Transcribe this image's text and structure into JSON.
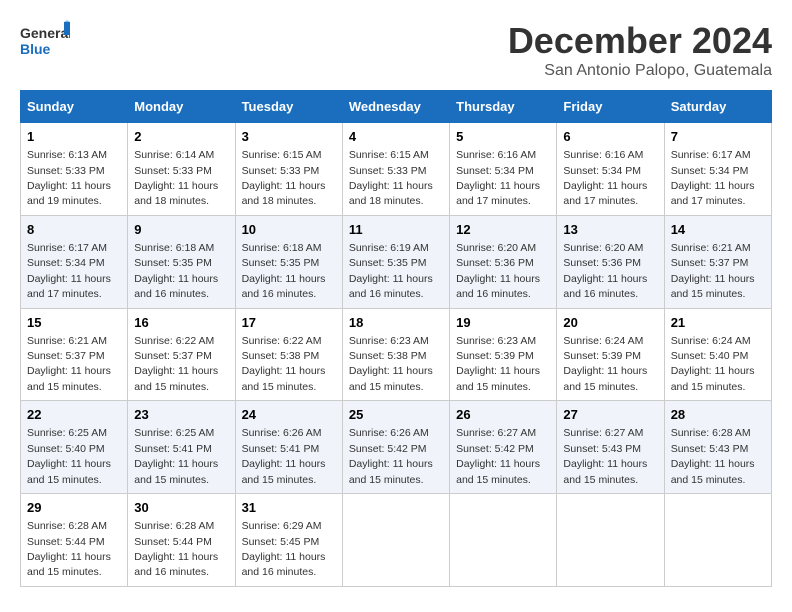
{
  "logo": {
    "line1": "General",
    "line2": "Blue"
  },
  "title": "December 2024",
  "subtitle": "San Antonio Palopo, Guatemala",
  "weekdays": [
    "Sunday",
    "Monday",
    "Tuesday",
    "Wednesday",
    "Thursday",
    "Friday",
    "Saturday"
  ],
  "weeks": [
    [
      {
        "day": "1",
        "sunrise": "6:13 AM",
        "sunset": "5:33 PM",
        "daylight": "11 hours and 19 minutes."
      },
      {
        "day": "2",
        "sunrise": "6:14 AM",
        "sunset": "5:33 PM",
        "daylight": "11 hours and 18 minutes."
      },
      {
        "day": "3",
        "sunrise": "6:15 AM",
        "sunset": "5:33 PM",
        "daylight": "11 hours and 18 minutes."
      },
      {
        "day": "4",
        "sunrise": "6:15 AM",
        "sunset": "5:33 PM",
        "daylight": "11 hours and 18 minutes."
      },
      {
        "day": "5",
        "sunrise": "6:16 AM",
        "sunset": "5:34 PM",
        "daylight": "11 hours and 17 minutes."
      },
      {
        "day": "6",
        "sunrise": "6:16 AM",
        "sunset": "5:34 PM",
        "daylight": "11 hours and 17 minutes."
      },
      {
        "day": "7",
        "sunrise": "6:17 AM",
        "sunset": "5:34 PM",
        "daylight": "11 hours and 17 minutes."
      }
    ],
    [
      {
        "day": "8",
        "sunrise": "6:17 AM",
        "sunset": "5:34 PM",
        "daylight": "11 hours and 17 minutes."
      },
      {
        "day": "9",
        "sunrise": "6:18 AM",
        "sunset": "5:35 PM",
        "daylight": "11 hours and 16 minutes."
      },
      {
        "day": "10",
        "sunrise": "6:18 AM",
        "sunset": "5:35 PM",
        "daylight": "11 hours and 16 minutes."
      },
      {
        "day": "11",
        "sunrise": "6:19 AM",
        "sunset": "5:35 PM",
        "daylight": "11 hours and 16 minutes."
      },
      {
        "day": "12",
        "sunrise": "6:20 AM",
        "sunset": "5:36 PM",
        "daylight": "11 hours and 16 minutes."
      },
      {
        "day": "13",
        "sunrise": "6:20 AM",
        "sunset": "5:36 PM",
        "daylight": "11 hours and 16 minutes."
      },
      {
        "day": "14",
        "sunrise": "6:21 AM",
        "sunset": "5:37 PM",
        "daylight": "11 hours and 15 minutes."
      }
    ],
    [
      {
        "day": "15",
        "sunrise": "6:21 AM",
        "sunset": "5:37 PM",
        "daylight": "11 hours and 15 minutes."
      },
      {
        "day": "16",
        "sunrise": "6:22 AM",
        "sunset": "5:37 PM",
        "daylight": "11 hours and 15 minutes."
      },
      {
        "day": "17",
        "sunrise": "6:22 AM",
        "sunset": "5:38 PM",
        "daylight": "11 hours and 15 minutes."
      },
      {
        "day": "18",
        "sunrise": "6:23 AM",
        "sunset": "5:38 PM",
        "daylight": "11 hours and 15 minutes."
      },
      {
        "day": "19",
        "sunrise": "6:23 AM",
        "sunset": "5:39 PM",
        "daylight": "11 hours and 15 minutes."
      },
      {
        "day": "20",
        "sunrise": "6:24 AM",
        "sunset": "5:39 PM",
        "daylight": "11 hours and 15 minutes."
      },
      {
        "day": "21",
        "sunrise": "6:24 AM",
        "sunset": "5:40 PM",
        "daylight": "11 hours and 15 minutes."
      }
    ],
    [
      {
        "day": "22",
        "sunrise": "6:25 AM",
        "sunset": "5:40 PM",
        "daylight": "11 hours and 15 minutes."
      },
      {
        "day": "23",
        "sunrise": "6:25 AM",
        "sunset": "5:41 PM",
        "daylight": "11 hours and 15 minutes."
      },
      {
        "day": "24",
        "sunrise": "6:26 AM",
        "sunset": "5:41 PM",
        "daylight": "11 hours and 15 minutes."
      },
      {
        "day": "25",
        "sunrise": "6:26 AM",
        "sunset": "5:42 PM",
        "daylight": "11 hours and 15 minutes."
      },
      {
        "day": "26",
        "sunrise": "6:27 AM",
        "sunset": "5:42 PM",
        "daylight": "11 hours and 15 minutes."
      },
      {
        "day": "27",
        "sunrise": "6:27 AM",
        "sunset": "5:43 PM",
        "daylight": "11 hours and 15 minutes."
      },
      {
        "day": "28",
        "sunrise": "6:28 AM",
        "sunset": "5:43 PM",
        "daylight": "11 hours and 15 minutes."
      }
    ],
    [
      {
        "day": "29",
        "sunrise": "6:28 AM",
        "sunset": "5:44 PM",
        "daylight": "11 hours and 15 minutes."
      },
      {
        "day": "30",
        "sunrise": "6:28 AM",
        "sunset": "5:44 PM",
        "daylight": "11 hours and 16 minutes."
      },
      {
        "day": "31",
        "sunrise": "6:29 AM",
        "sunset": "5:45 PM",
        "daylight": "11 hours and 16 minutes."
      },
      null,
      null,
      null,
      null
    ]
  ]
}
